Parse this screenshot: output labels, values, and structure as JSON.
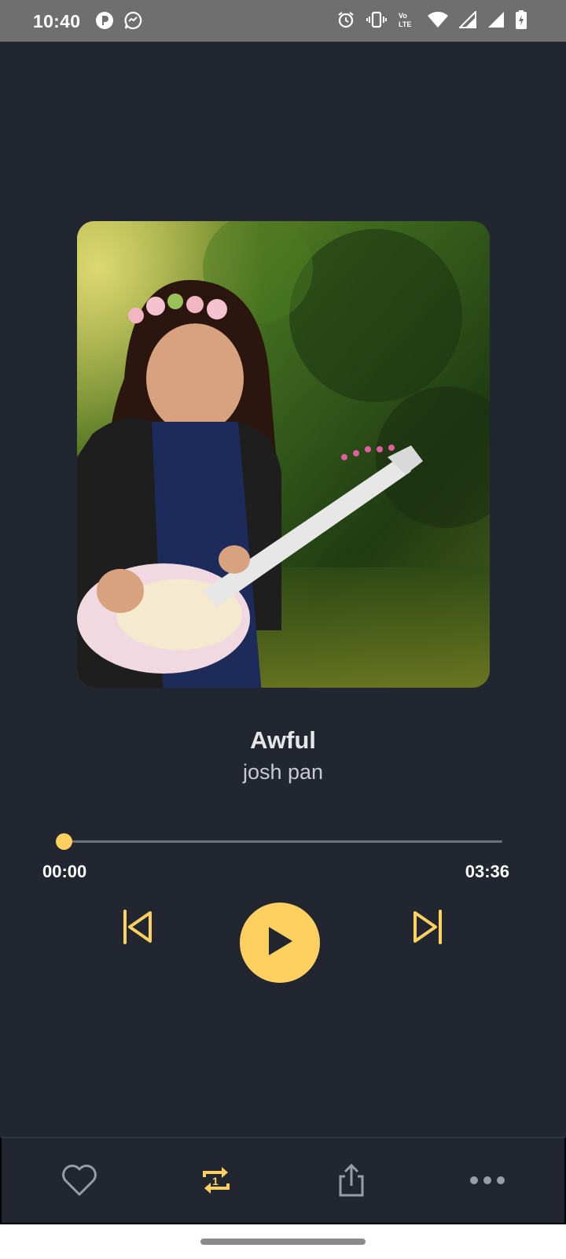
{
  "status_bar": {
    "time": "10:40",
    "network_label": "Vo LTE"
  },
  "player": {
    "song_title": "Awful",
    "artist": "josh pan",
    "current_time": "00:00",
    "total_time": "03:36",
    "progress": 0.0
  },
  "colors": {
    "background": "#212631",
    "accent": "#fdd05f",
    "status_bar": "#6f6f6f"
  },
  "icons": {
    "previous": "skip-previous-icon",
    "play": "play-icon",
    "next": "skip-next-icon",
    "like": "heart-icon",
    "repeat": "repeat-one-icon",
    "share": "share-icon",
    "more": "more-horizontal-icon"
  }
}
